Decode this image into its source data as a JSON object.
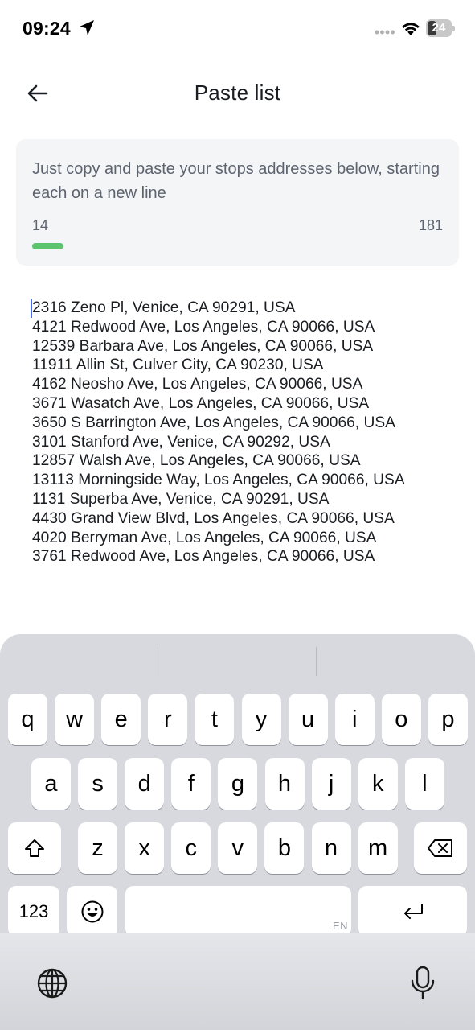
{
  "status_bar": {
    "time": "09:24",
    "battery_level": "24"
  },
  "header": {
    "title": "Paste list",
    "back_icon": "arrow-left-icon"
  },
  "info_card": {
    "instructions": "Just copy and paste your stops addresses below, starting each on a new line",
    "stop_count": "14",
    "char_limit": "181",
    "progress_fraction": 0.077,
    "progress_color": "#5cc46e"
  },
  "addresses": [
    "2316 Zeno Pl, Venice, CA 90291, USA",
    "4121 Redwood Ave, Los Angeles, CA 90066, USA",
    "12539 Barbara Ave, Los Angeles, CA 90066, USA",
    "11911 Allin St, Culver City, CA 90230, USA",
    "4162 Neosho Ave, Los Angeles, CA 90066, USA",
    "3671 Wasatch Ave, Los Angeles, CA 90066, USA",
    "3650 S Barrington Ave, Los Angeles, CA 90066, USA",
    "3101 Stanford Ave, Venice, CA 90292, USA",
    "12857 Walsh Ave, Los Angeles, CA 90066, USA",
    "13113 Morningside Way, Los Angeles, CA 90066, USA",
    "1131 Superba Ave, Venice, CA 90291, USA",
    "4430 Grand View Blvd, Los Angeles, CA 90066, USA",
    "4020 Berryman Ave, Los Angeles, CA 90066, USA",
    "3761 Redwood Ave, Los Angeles, CA 90066, USA"
  ],
  "keyboard": {
    "row1": [
      "q",
      "w",
      "e",
      "r",
      "t",
      "y",
      "u",
      "i",
      "o",
      "p"
    ],
    "row2": [
      "a",
      "s",
      "d",
      "f",
      "g",
      "h",
      "j",
      "k",
      "l"
    ],
    "row3": [
      "z",
      "x",
      "c",
      "v",
      "b",
      "n",
      "m"
    ],
    "numbers_label": "123",
    "language_tag": "EN",
    "accent_color": "#4a6cf0"
  }
}
